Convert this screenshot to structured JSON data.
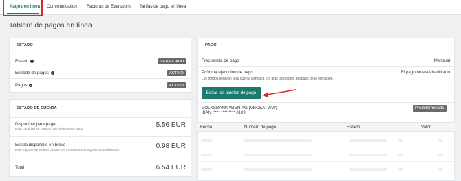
{
  "nav": {
    "tabs": [
      {
        "label": "Pagos en línea",
        "active": true
      },
      {
        "label": "Communication"
      },
      {
        "label": "Facturas de Eversports"
      },
      {
        "label": "Tarifas de pago en línea"
      }
    ]
  },
  "page": {
    "title": "Tablero de pagos en línea"
  },
  "status_card": {
    "title": "ESTADO",
    "rows": [
      {
        "label": "Estado",
        "badge": "VERIFICADO"
      },
      {
        "label": "Entrada de pagos",
        "badge": "ACTIVO"
      },
      {
        "label": "Pagos",
        "badge": "ACTIVO"
      }
    ]
  },
  "account_card": {
    "title": "ESTADO DE CUENTA",
    "available": {
      "title": "Disponible para pagar",
      "sub": "Esta cantidad se pagará con el siguiente pago",
      "amount": "5.56 EUR"
    },
    "soon": {
      "title": "Estará disponible en breve",
      "sub": "Este importe se estima porque las transacciones siguen acumulándose",
      "amount": "0.98 EUR"
    },
    "total": {
      "title": "Total",
      "amount": "6.54 EUR"
    }
  },
  "payment_card": {
    "title": "PAGO",
    "frequency_label": "Frecuencia de pago",
    "frequency_value": "Mensual",
    "next_label": "Próxima ejecución de pago",
    "next_value": "El pago no está habilitado",
    "next_note": "Los fondos llegarán a su cuenta bancaria 2-5 días laborables después de la ejecución.",
    "edit_button": "Editar los ajustes de pago",
    "bank_name": "VOLKSBANK WIEN AG (VBOEATWW)",
    "iban": "IBAN: **** **** **** 0109",
    "default_badge": "Predeterminado",
    "table_headers": [
      "Fecha",
      "Número de pago",
      "Estado",
      "Valor"
    ]
  },
  "colors": {
    "accent": "#1a7a6c",
    "annotation_red": "#d62a2a",
    "badge_gray": "#6a6a6a"
  }
}
